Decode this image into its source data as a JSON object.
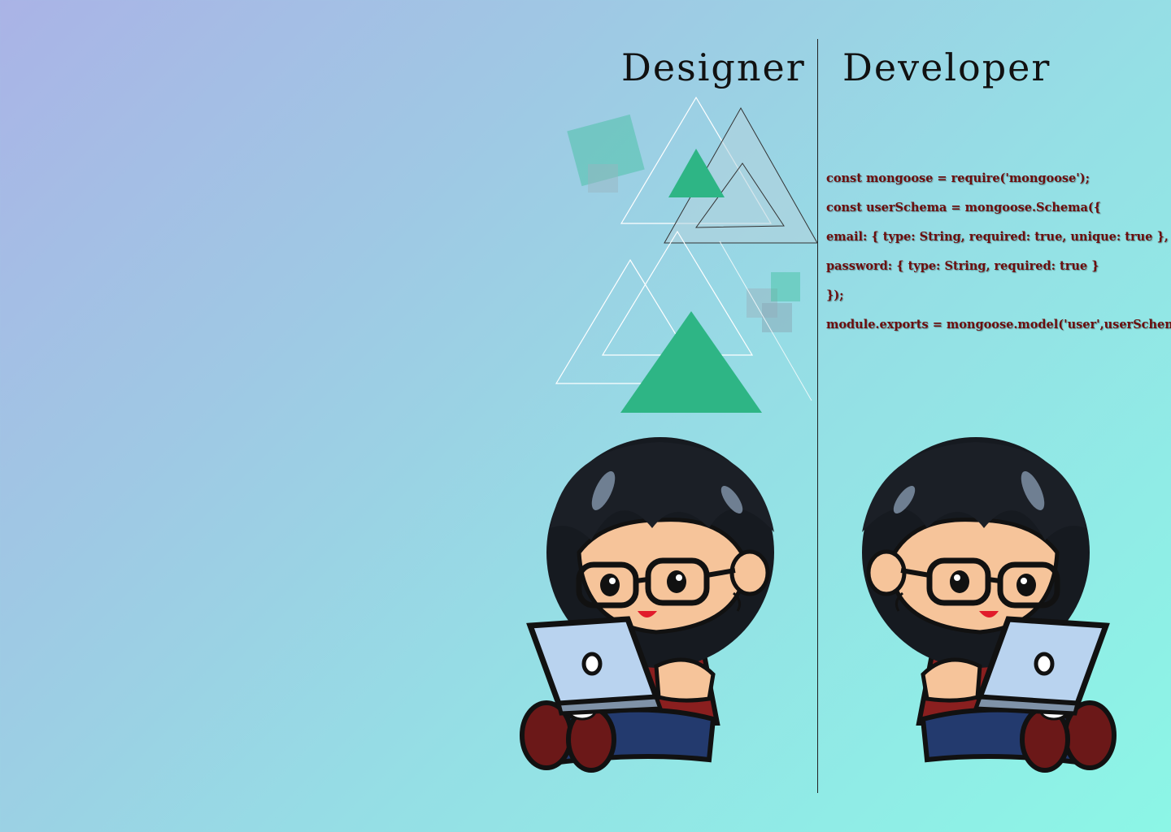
{
  "headings": {
    "designer": "Designer",
    "developer": "Developer"
  },
  "code_lines": [
    "const mongoose = require('mongoose');",
    "const userSchema = mongoose.Schema({",
    "email: { type: String, required: true, unique: true },",
    "password: { type: String, required: true }",
    "});",
    "module.exports = mongoose.model('user',userSchema);"
  ],
  "colors": {
    "triangle_fill": "#2eb585",
    "code_text": "#6b0e0e",
    "heading_text": "#111111",
    "shirt": "#8a1f1f",
    "laptop": "#b9d3ef"
  },
  "icons": {
    "designer_avatar": "character-with-laptop",
    "developer_avatar": "character-with-laptop"
  }
}
